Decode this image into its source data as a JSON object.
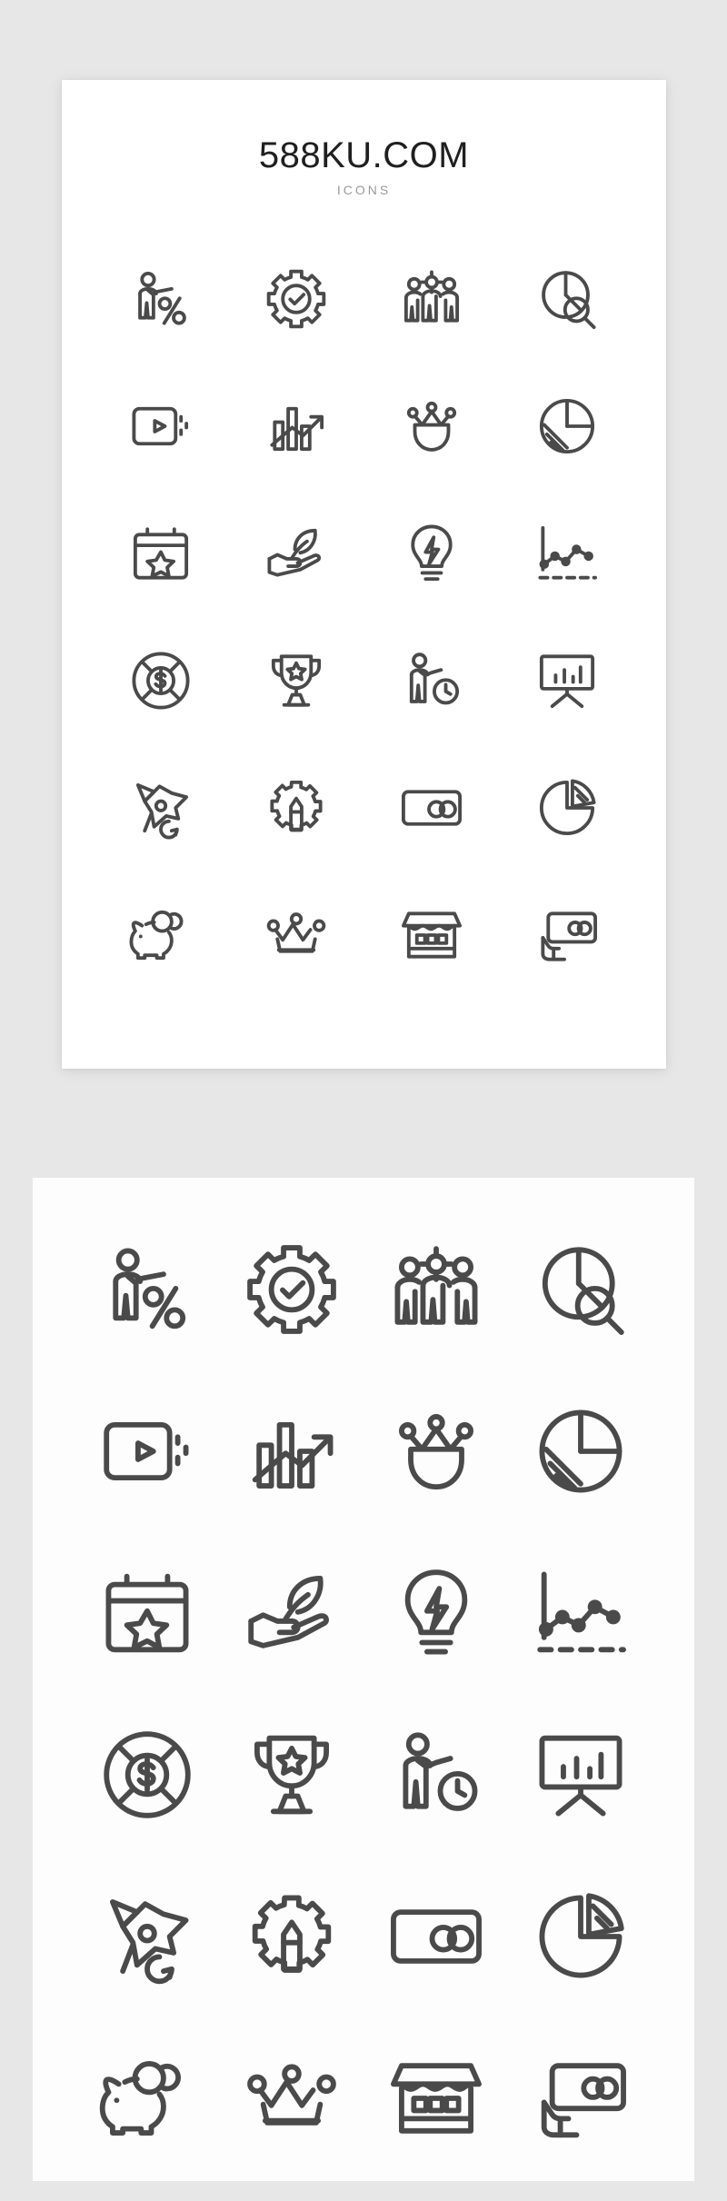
{
  "poster": {
    "title": "588KU.COM",
    "subtitle": "ICONS"
  },
  "theme": {
    "page_background": "#e7e7e7",
    "card_background": "#ffffff",
    "icon_stroke": "#4a4a4a",
    "title_color": "#1f1f1f",
    "subtitle_color": "#9a9a9a"
  },
  "grid": {
    "columns": 4,
    "rows": 6,
    "total_icons": 24
  },
  "icons": [
    {
      "id": "person-percent",
      "name": "person-pointing-percent-icon",
      "label": "Person with percent"
    },
    {
      "id": "gear-check",
      "name": "gear-check-icon",
      "label": "Gear with check"
    },
    {
      "id": "team-three",
      "name": "team-three-people-icon",
      "label": "Team of three"
    },
    {
      "id": "pie-search",
      "name": "pie-chart-magnifier-icon",
      "label": "Pie chart search"
    },
    {
      "id": "video-play",
      "name": "video-play-screen-icon",
      "label": "Video player"
    },
    {
      "id": "bar-growth-arrow",
      "name": "bar-chart-growth-arrow-icon",
      "label": "Growth bar chart"
    },
    {
      "id": "crown-cup",
      "name": "crown-cup-icon",
      "label": "Crown cup"
    },
    {
      "id": "pie-striped",
      "name": "pie-chart-striped-icon",
      "label": "Striped pie chart"
    },
    {
      "id": "calendar-star",
      "name": "calendar-star-icon",
      "label": "Calendar with star"
    },
    {
      "id": "hand-leaf",
      "name": "hand-holding-leaf-icon",
      "label": "Hand holding leaf"
    },
    {
      "id": "bulb-bolt",
      "name": "lightbulb-bolt-icon",
      "label": "Idea bulb"
    },
    {
      "id": "line-chart-dashed",
      "name": "line-chart-dashed-axis-icon",
      "label": "Line chart"
    },
    {
      "id": "dollar-lifebuoy",
      "name": "dollar-lifebuoy-icon",
      "label": "Dollar support ring"
    },
    {
      "id": "trophy-star",
      "name": "trophy-star-icon",
      "label": "Trophy with star"
    },
    {
      "id": "person-clock",
      "name": "person-clock-icon",
      "label": "Person with clock"
    },
    {
      "id": "presentation-bars",
      "name": "presentation-board-bars-icon",
      "label": "Presentation board"
    },
    {
      "id": "rocket-launch",
      "name": "rocket-launch-icon",
      "label": "Rocket launch"
    },
    {
      "id": "gear-pencil",
      "name": "gear-pencil-icon",
      "label": "Gear with pencil"
    },
    {
      "id": "card-coins",
      "name": "card-coins-icon",
      "label": "Card with coins"
    },
    {
      "id": "pie-quarter",
      "name": "pie-chart-quarter-slice-icon",
      "label": "Pie quarter slice"
    },
    {
      "id": "piggy-bank",
      "name": "piggy-bank-coin-icon",
      "label": "Piggy bank"
    },
    {
      "id": "crown",
      "name": "crown-icon",
      "label": "Crown"
    },
    {
      "id": "storefront",
      "name": "storefront-shop-icon",
      "label": "Storefront"
    },
    {
      "id": "hand-card-coins",
      "name": "hand-card-coins-icon",
      "label": "Hand with card"
    }
  ]
}
